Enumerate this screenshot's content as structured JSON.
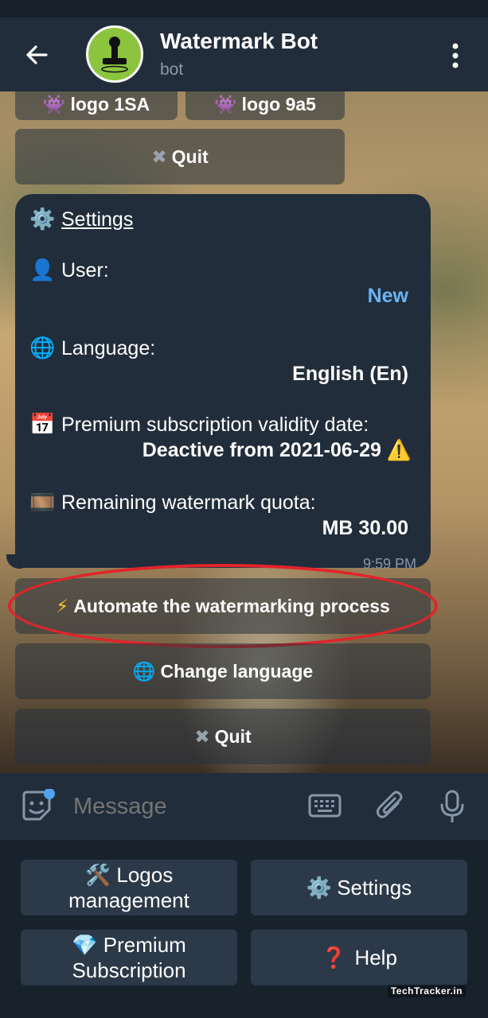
{
  "header": {
    "title": "Watermark Bot",
    "subtitle": "bot"
  },
  "chat": {
    "prev_keyboard": {
      "logo_a": "logo 1SA",
      "logo_b": "logo 9a5",
      "quit": "Quit"
    },
    "settings_message": {
      "title": "Settings",
      "user_label": "User:",
      "user_value": "New",
      "language_label": "Language:",
      "language_value": "English (En)",
      "premium_label": "Premium subscription validity date:",
      "premium_value": "Deactive from 2021-06-29",
      "quota_label": "Remaining watermark quota:",
      "quota_value": "MB 30.00",
      "time": "9:59 PM"
    },
    "inline_keyboard": {
      "automate": "Automate the watermarking process",
      "change_language": "Change language",
      "quit": "Quit"
    }
  },
  "input": {
    "placeholder": "Message"
  },
  "reply_keyboard": {
    "logos_line1": "Logos",
    "logos_line2": "management",
    "settings": "Settings",
    "premium_line1": "Premium",
    "premium_line2": "Subscription",
    "help": "Help"
  },
  "credit": "TechTracker.in",
  "colors": {
    "header_bg": "#212d3b",
    "bubble_bg": "#212d3b",
    "link": "#6ab3f3",
    "highlight": "#e0242b",
    "avatar_bg": "#8cc43f"
  }
}
